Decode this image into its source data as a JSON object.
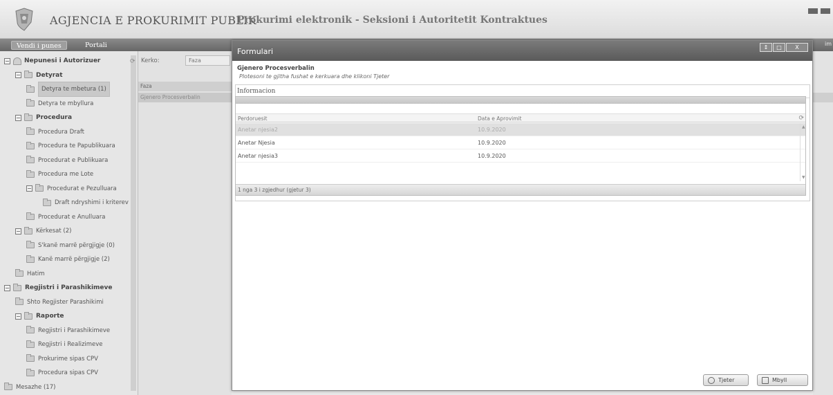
{
  "header": {
    "agency_title": "AGJENCIA E PROKURIMIT PUBLIK",
    "section_title": "Prokurimi elektronik - Seksioni i Autoritetit Kontraktues"
  },
  "nav": {
    "active_tab": "Vendi i punes",
    "tab2": "Portali",
    "right_text": "im"
  },
  "sidebar": {
    "items": [
      {
        "label": "Nepunesi i Autorizuer",
        "level": 0,
        "toggle": "⊟",
        "icon": "person-icon",
        "bold": true
      },
      {
        "label": "Detyrat",
        "level": 1,
        "toggle": "⊟",
        "icon": "folder-icon",
        "bold": true
      },
      {
        "label": "Detyra te mbetura (1)",
        "level": 2,
        "icon": "folder-icon",
        "selected": true
      },
      {
        "label": "Detyra te mbyllura",
        "level": 2,
        "icon": "folder-icon"
      },
      {
        "label": "Procedura",
        "level": 1,
        "toggle": "⊟",
        "icon": "folder-icon",
        "bold": true
      },
      {
        "label": "Procedura Draft",
        "level": 2,
        "icon": "folder-icon"
      },
      {
        "label": "Procedura te Papublikuara",
        "level": 2,
        "icon": "folder-icon"
      },
      {
        "label": "Procedurat e Publikuara",
        "level": 2,
        "icon": "folder-icon"
      },
      {
        "label": "Procedura me Lote",
        "level": 2,
        "icon": "folder-icon"
      },
      {
        "label": "Procedurat e Pezulluara",
        "level": 2,
        "toggle": "⊟",
        "icon": "folder-icon"
      },
      {
        "label": "Draft ndryshimi i kriterev",
        "level": 3,
        "icon": "folder-icon"
      },
      {
        "label": "Procedurat e Anulluara",
        "level": 2,
        "icon": "folder-icon"
      },
      {
        "label": "Kërkesat (2)",
        "level": 1,
        "toggle": "⊟",
        "icon": "folder-icon"
      },
      {
        "label": "S'kanë marrë përgjigje (0)",
        "level": 2,
        "icon": "folder-icon"
      },
      {
        "label": "Kanë marrë përgjigje (2)",
        "level": 2,
        "icon": "folder-icon"
      },
      {
        "label": "Hatim",
        "level": 1,
        "icon": "folder-icon"
      },
      {
        "label": "Regjistri i Parashikimeve",
        "level": 0,
        "toggle": "⊟",
        "icon": "folder-icon",
        "bold": true
      },
      {
        "label": "Shto Regjister Parashikimi",
        "level": 1,
        "icon": "folder-icon"
      },
      {
        "label": "Raporte",
        "level": 1,
        "toggle": "⊟",
        "icon": "folder-icon",
        "bold": true
      },
      {
        "label": "Regjistri i Parashikimeve",
        "level": 2,
        "icon": "folder-icon"
      },
      {
        "label": "Regjistri i Realizimeve",
        "level": 2,
        "icon": "folder-icon"
      },
      {
        "label": "Prokurime sipas CPV",
        "level": 2,
        "icon": "folder-icon"
      },
      {
        "label": "Procedura sipas CPV",
        "level": 2,
        "icon": "folder-icon"
      },
      {
        "label": "Mesazhe (17)",
        "level": 0,
        "icon": "folder-icon"
      }
    ]
  },
  "middle": {
    "search_label": "Kerko:",
    "search_value": "Faza",
    "column_header": "Faza",
    "row": "Gjenero Procesverbalin",
    "refresh_glyph": "⟳"
  },
  "dialog": {
    "title": "Formulari",
    "win_buttons": [
      "↕",
      "□",
      "X"
    ],
    "heading": "Gjenero Procesverbalin",
    "subtitle": "Plotesoni te gjitha fushat e kerkuara dhe klikoni Tjeter",
    "panel_title": "Informacion",
    "grid": {
      "columns": [
        "Perdoruesit",
        "Data e Aprovimit"
      ],
      "rows": [
        {
          "user": "Anetar njesia2",
          "date": "10.9.2020",
          "selected": true
        },
        {
          "user": "Anetar Njesia",
          "date": "10.9.2020"
        },
        {
          "user": "Anetar njesia3",
          "date": "10.9.2020"
        }
      ],
      "footer": "1 nga 3 i zgjedhur (gjetur 3)"
    },
    "buttons": {
      "next": "Tjeter",
      "close": "Mbyll"
    }
  }
}
